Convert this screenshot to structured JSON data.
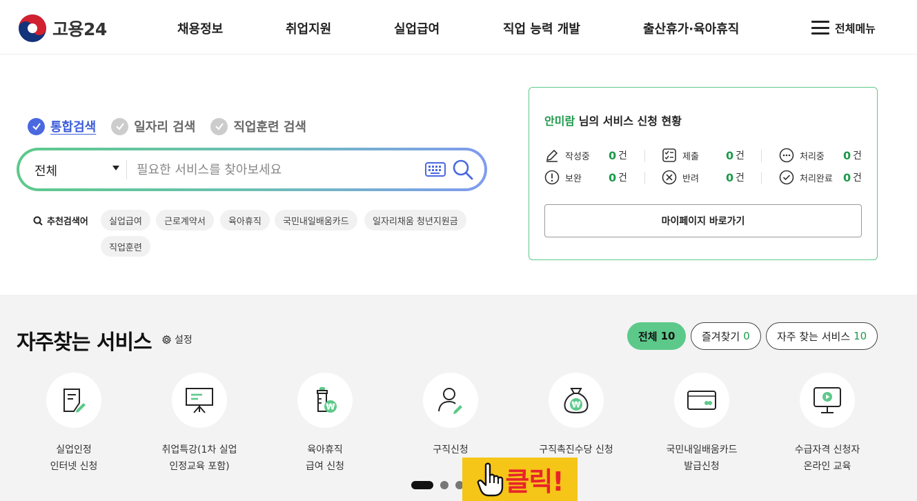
{
  "header": {
    "logo_text": "고용24",
    "nav": [
      "채용정보",
      "취업지원",
      "실업급여",
      "직업 능력 개발",
      "출산휴가·육아휴직"
    ],
    "menu_label": "전체메뉴"
  },
  "search": {
    "tabs": [
      {
        "label": "통합검색",
        "active": true
      },
      {
        "label": "일자리 검색",
        "active": false
      },
      {
        "label": "직업훈련 검색",
        "active": false
      }
    ],
    "select_value": "전체",
    "placeholder": "필요한 서비스를 찾아보세요",
    "recommend_label": "추천검색어",
    "keywords": [
      "실업급여",
      "근로계약서",
      "육아휴직",
      "국민내일배움카드",
      "일자리채움 청년지원금",
      "직업훈련"
    ]
  },
  "status": {
    "user_name": "안미람",
    "title_suffix": "님의 서비스 신청 현황",
    "items": [
      {
        "label": "작성중",
        "count": "0",
        "unit": "건",
        "icon": "pencil-icon"
      },
      {
        "label": "제출",
        "count": "0",
        "unit": "건",
        "icon": "checklist-icon"
      },
      {
        "label": "처리중",
        "count": "0",
        "unit": "건",
        "icon": "ellipsis-circle-icon"
      },
      {
        "label": "보완",
        "count": "0",
        "unit": "건",
        "icon": "exclamation-circle-icon"
      },
      {
        "label": "반려",
        "count": "0",
        "unit": "건",
        "icon": "x-circle-icon"
      },
      {
        "label": "처리완료",
        "count": "0",
        "unit": "건",
        "icon": "check-circle-icon"
      }
    ],
    "mypage_button": "마이페이지 바로가기"
  },
  "services": {
    "title": "자주찾는 서비스",
    "setting_label": "설정",
    "filters": [
      {
        "label": "전체",
        "count": "10",
        "active": true
      },
      {
        "label": "즐겨찾기",
        "count": "0",
        "active": false
      },
      {
        "label": "자주 찾는 서비스",
        "count": "10",
        "active": false
      }
    ],
    "items": [
      {
        "line1": "실업인정",
        "line2": "인터넷 신청",
        "icon": "document-pen-icon"
      },
      {
        "line1": "취업특강(1차 실업",
        "line2": "인정교육 포함)",
        "icon": "presentation-board-icon"
      },
      {
        "line1": "육아휴직",
        "line2": "급여 신청",
        "icon": "baby-bottle-won-icon"
      },
      {
        "line1": "구직신청",
        "line2": "",
        "icon": "person-pen-icon"
      },
      {
        "line1": "구직촉진수당 신청",
        "line2": "",
        "icon": "money-bag-won-icon"
      },
      {
        "line1": "국민내일배움카드",
        "line2": "발급신청",
        "icon": "card-icon"
      },
      {
        "line1": "수급자격 신청자",
        "line2": "온라인 교육",
        "icon": "monitor-play-icon"
      }
    ],
    "pager_count": 3
  },
  "overlay": {
    "click_text": "클릭!"
  },
  "colors": {
    "accent_green": "#5cc98a",
    "text_green": "#1d9a4b",
    "accent_blue": "#4a68e0",
    "badge_yellow": "#f5c518",
    "badge_red": "#e8242a"
  }
}
